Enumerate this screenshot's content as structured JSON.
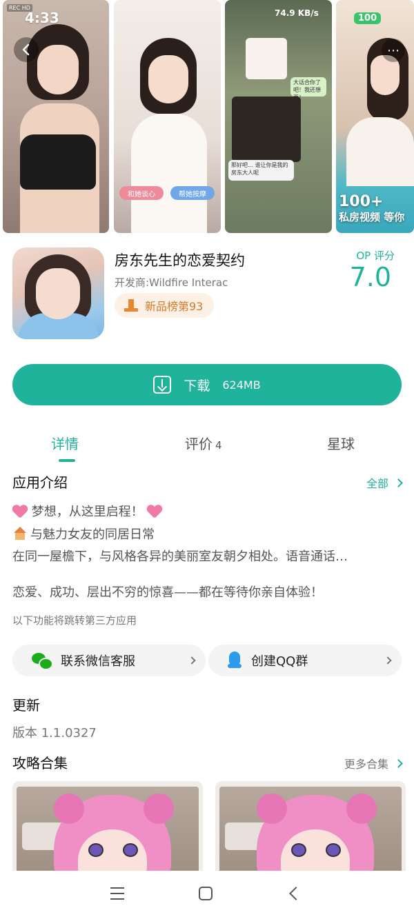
{
  "status": {
    "time": "4:33",
    "rec": "REC HD",
    "net_speed": "74.9 KB/s",
    "battery": "100"
  },
  "gallery": {
    "shot2_pills": [
      "和她谈心",
      "帮她按摩"
    ],
    "shot3_bubbles": [
      "大话合你了吧！我还想要！",
      "那好吧…\n谁让你是我的房东大人呢"
    ],
    "shot4_promo_big": "100+",
    "shot4_promo_sub": "私房视频 等你"
  },
  "app": {
    "title": "房东先生的恋爱契约",
    "developer": "开发商:Wildfire Interac",
    "rank_badge": "新品榜第93",
    "score_label": "OP 评分",
    "score_value": "7.0"
  },
  "download": {
    "label": "下载",
    "size": "624MB"
  },
  "tabs": [
    {
      "label": "详情"
    },
    {
      "label": "评价",
      "count": "4"
    },
    {
      "label": "星球"
    }
  ],
  "intro": {
    "title": "应用介绍",
    "more": "全部",
    "line1": "梦想，从这里启程！",
    "line2": "与魅力女友的同居日常",
    "line3": "在同一屋檐下，与风格各异的美丽室友朝夕相处。语音通话…",
    "line4": "恋爱、成功、层出不穷的惊喜——都在等待你亲自体验！",
    "third_party_note": "以下功能将跳转第三方应用"
  },
  "contacts": {
    "wechat": "联系微信客服",
    "qq": "创建QQ群"
  },
  "update": {
    "title": "更新",
    "version": "版本 1.1.0327"
  },
  "guides": {
    "title": "攻略合集",
    "more": "更多合集"
  },
  "colors": {
    "accent": "#1fb39b",
    "rank": "#d97a2a",
    "rank_bg": "#fdf0e5"
  }
}
